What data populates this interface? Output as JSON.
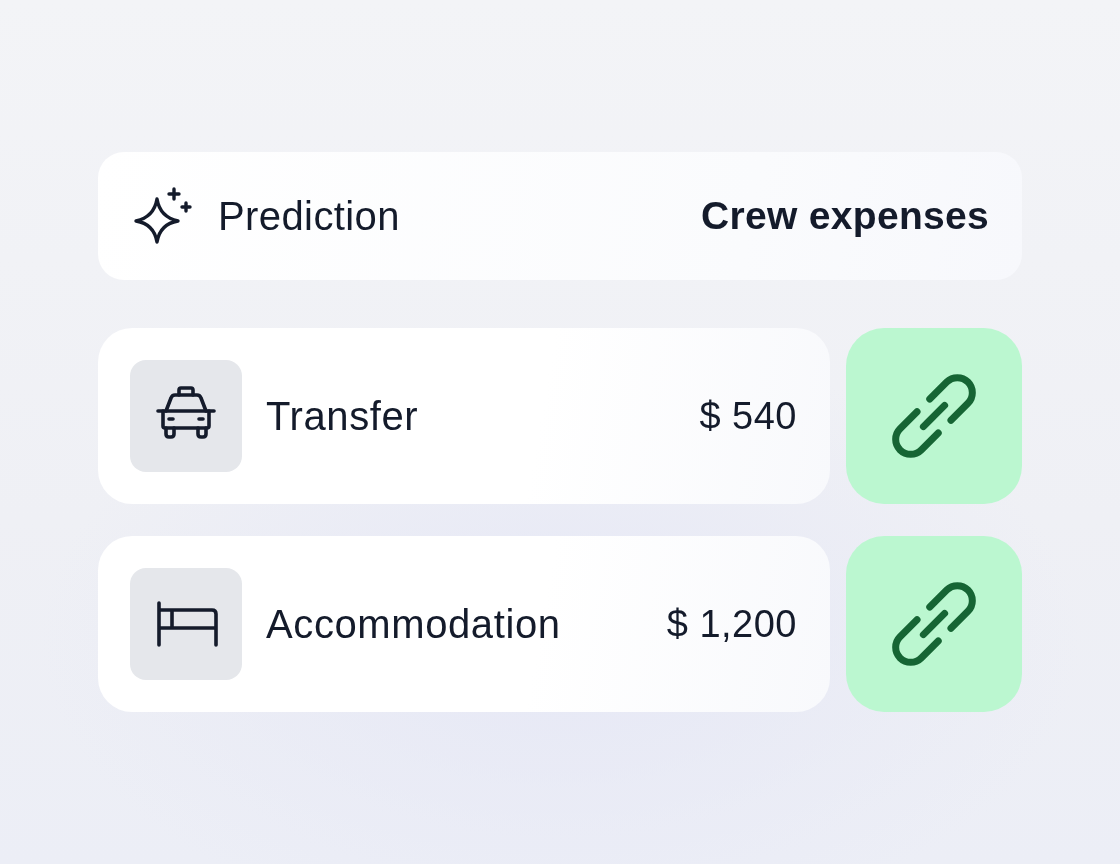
{
  "header": {
    "label": "Prediction",
    "value": "Crew expenses"
  },
  "expenses": [
    {
      "kind": "taxi",
      "name": "Transfer",
      "amount": "$ 540"
    },
    {
      "kind": "bed",
      "name": "Accommodation",
      "amount": "$ 1,200"
    }
  ]
}
